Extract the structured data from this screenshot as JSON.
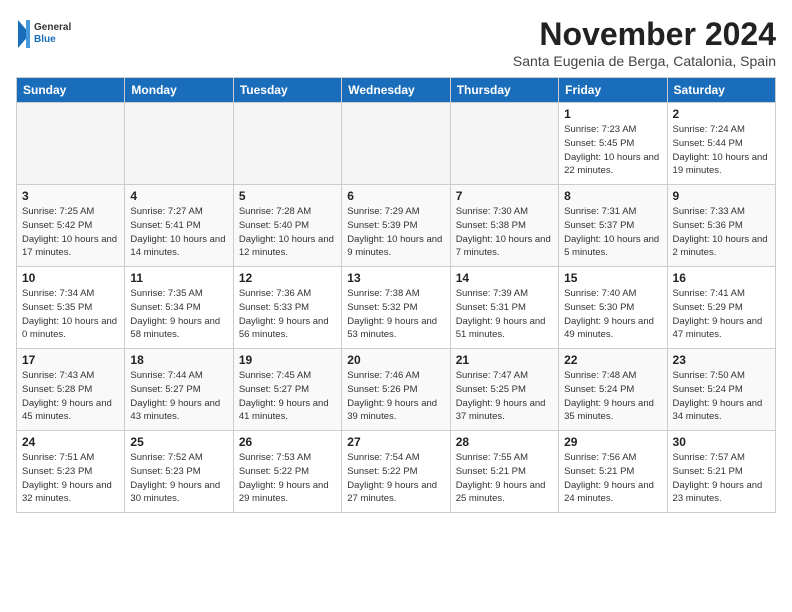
{
  "logo": {
    "general": "General",
    "blue": "Blue"
  },
  "title": "November 2024",
  "location": "Santa Eugenia de Berga, Catalonia, Spain",
  "weekdays": [
    "Sunday",
    "Monday",
    "Tuesday",
    "Wednesday",
    "Thursday",
    "Friday",
    "Saturday"
  ],
  "weeks": [
    [
      {
        "day": "",
        "empty": true
      },
      {
        "day": "",
        "empty": true
      },
      {
        "day": "",
        "empty": true
      },
      {
        "day": "",
        "empty": true
      },
      {
        "day": "",
        "empty": true
      },
      {
        "day": "1",
        "sunrise": "7:23 AM",
        "sunset": "5:45 PM",
        "daylight": "10 hours and 22 minutes."
      },
      {
        "day": "2",
        "sunrise": "7:24 AM",
        "sunset": "5:44 PM",
        "daylight": "10 hours and 19 minutes."
      }
    ],
    [
      {
        "day": "3",
        "sunrise": "7:25 AM",
        "sunset": "5:42 PM",
        "daylight": "10 hours and 17 minutes."
      },
      {
        "day": "4",
        "sunrise": "7:27 AM",
        "sunset": "5:41 PM",
        "daylight": "10 hours and 14 minutes."
      },
      {
        "day": "5",
        "sunrise": "7:28 AM",
        "sunset": "5:40 PM",
        "daylight": "10 hours and 12 minutes."
      },
      {
        "day": "6",
        "sunrise": "7:29 AM",
        "sunset": "5:39 PM",
        "daylight": "10 hours and 9 minutes."
      },
      {
        "day": "7",
        "sunrise": "7:30 AM",
        "sunset": "5:38 PM",
        "daylight": "10 hours and 7 minutes."
      },
      {
        "day": "8",
        "sunrise": "7:31 AM",
        "sunset": "5:37 PM",
        "daylight": "10 hours and 5 minutes."
      },
      {
        "day": "9",
        "sunrise": "7:33 AM",
        "sunset": "5:36 PM",
        "daylight": "10 hours and 2 minutes."
      }
    ],
    [
      {
        "day": "10",
        "sunrise": "7:34 AM",
        "sunset": "5:35 PM",
        "daylight": "10 hours and 0 minutes."
      },
      {
        "day": "11",
        "sunrise": "7:35 AM",
        "sunset": "5:34 PM",
        "daylight": "9 hours and 58 minutes."
      },
      {
        "day": "12",
        "sunrise": "7:36 AM",
        "sunset": "5:33 PM",
        "daylight": "9 hours and 56 minutes."
      },
      {
        "day": "13",
        "sunrise": "7:38 AM",
        "sunset": "5:32 PM",
        "daylight": "9 hours and 53 minutes."
      },
      {
        "day": "14",
        "sunrise": "7:39 AM",
        "sunset": "5:31 PM",
        "daylight": "9 hours and 51 minutes."
      },
      {
        "day": "15",
        "sunrise": "7:40 AM",
        "sunset": "5:30 PM",
        "daylight": "9 hours and 49 minutes."
      },
      {
        "day": "16",
        "sunrise": "7:41 AM",
        "sunset": "5:29 PM",
        "daylight": "9 hours and 47 minutes."
      }
    ],
    [
      {
        "day": "17",
        "sunrise": "7:43 AM",
        "sunset": "5:28 PM",
        "daylight": "9 hours and 45 minutes."
      },
      {
        "day": "18",
        "sunrise": "7:44 AM",
        "sunset": "5:27 PM",
        "daylight": "9 hours and 43 minutes."
      },
      {
        "day": "19",
        "sunrise": "7:45 AM",
        "sunset": "5:27 PM",
        "daylight": "9 hours and 41 minutes."
      },
      {
        "day": "20",
        "sunrise": "7:46 AM",
        "sunset": "5:26 PM",
        "daylight": "9 hours and 39 minutes."
      },
      {
        "day": "21",
        "sunrise": "7:47 AM",
        "sunset": "5:25 PM",
        "daylight": "9 hours and 37 minutes."
      },
      {
        "day": "22",
        "sunrise": "7:48 AM",
        "sunset": "5:24 PM",
        "daylight": "9 hours and 35 minutes."
      },
      {
        "day": "23",
        "sunrise": "7:50 AM",
        "sunset": "5:24 PM",
        "daylight": "9 hours and 34 minutes."
      }
    ],
    [
      {
        "day": "24",
        "sunrise": "7:51 AM",
        "sunset": "5:23 PM",
        "daylight": "9 hours and 32 minutes."
      },
      {
        "day": "25",
        "sunrise": "7:52 AM",
        "sunset": "5:23 PM",
        "daylight": "9 hours and 30 minutes."
      },
      {
        "day": "26",
        "sunrise": "7:53 AM",
        "sunset": "5:22 PM",
        "daylight": "9 hours and 29 minutes."
      },
      {
        "day": "27",
        "sunrise": "7:54 AM",
        "sunset": "5:22 PM",
        "daylight": "9 hours and 27 minutes."
      },
      {
        "day": "28",
        "sunrise": "7:55 AM",
        "sunset": "5:21 PM",
        "daylight": "9 hours and 25 minutes."
      },
      {
        "day": "29",
        "sunrise": "7:56 AM",
        "sunset": "5:21 PM",
        "daylight": "9 hours and 24 minutes."
      },
      {
        "day": "30",
        "sunrise": "7:57 AM",
        "sunset": "5:21 PM",
        "daylight": "9 hours and 23 minutes."
      }
    ]
  ]
}
